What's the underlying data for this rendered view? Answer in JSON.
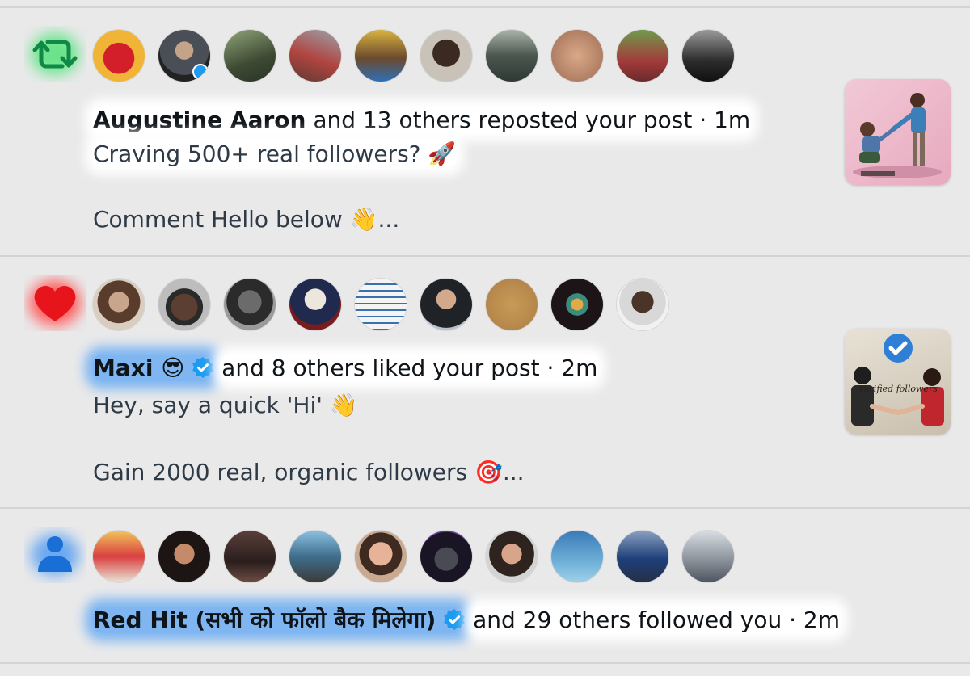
{
  "colors": {
    "repost": "#17bf63",
    "like": "#f91880",
    "follow": "#1d9bf0",
    "verified": "#1d9bf0",
    "text": "#0f1419",
    "background": "#e9e9ea",
    "divider": "#d3d4d6"
  },
  "notifications": [
    {
      "type": "repost",
      "icon": "repost-icon",
      "actor": "Augustine Aaron",
      "action": "and 13 others reposted your post · 1m",
      "preview_line1": "Craving 500+ real followers? 🚀",
      "preview_line2": "Comment Hello below 👋...",
      "avatars": [
        "avatar-1",
        "avatar-2",
        "avatar-3",
        "avatar-4",
        "avatar-5",
        "avatar-6",
        "avatar-7",
        "avatar-8",
        "avatar-9",
        "avatar-10"
      ],
      "thumbnail": "post-thumbnail-icon"
    },
    {
      "type": "like",
      "icon": "heart-icon",
      "actor": "Maxi 😎",
      "action": "and 8 others liked your post · 2m",
      "preview_line1": "Hey, say a quick 'Hi' 👋",
      "preview_line2": "Gain 2000 real, organic followers 🎯...",
      "thumbnail_text": "Verified followers",
      "avatars": [
        "avatar-1",
        "avatar-2",
        "avatar-3",
        "avatar-4",
        "avatar-5",
        "avatar-6",
        "avatar-7",
        "avatar-8",
        "avatar-9"
      ],
      "thumbnail": "post-thumbnail-icon"
    },
    {
      "type": "follow",
      "icon": "person-icon",
      "actor": "Red Hit (सभी को फॉलो बैक मिलेगा)",
      "action": "and 29 others followed you · 2m",
      "avatars": [
        "avatar-1",
        "avatar-2",
        "avatar-3",
        "avatar-4",
        "avatar-5",
        "avatar-6",
        "avatar-7",
        "avatar-8",
        "avatar-9",
        "avatar-10"
      ]
    }
  ]
}
